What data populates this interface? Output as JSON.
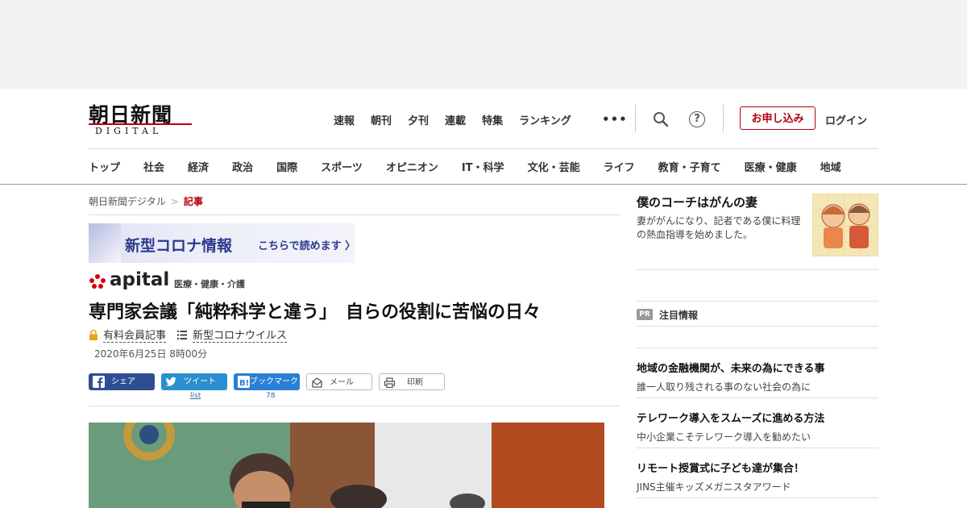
{
  "logo": {
    "main": "朝日新聞",
    "sub": "DIGITAL"
  },
  "top_nav": [
    "速報",
    "朝刊",
    "夕刊",
    "連載",
    "特集",
    "ランキング"
  ],
  "header": {
    "more_icon": "more-dots-icon",
    "signup_label": "お申し込み",
    "login_label": "ログイン"
  },
  "categories": [
    "トップ",
    "社会",
    "経済",
    "政治",
    "国際",
    "スポーツ",
    "オピニオン",
    "IT・科学",
    "文化・芸能",
    "ライフ",
    "教育・子育て",
    "医療・健康",
    "地域"
  ],
  "breadcrumb": {
    "home": "朝日新聞デジタル",
    "current": "記事"
  },
  "banner": {
    "title": "新型コロナ情報",
    "link": "こちらで読めます"
  },
  "apital": {
    "name": "apital",
    "category": "医療・健康・介護"
  },
  "article": {
    "headline": "専門家会議「純粋科学と違う」　自らの役割に苦悩の日々",
    "member_label": "有料会員記事",
    "topic": "新型コロナウイルス",
    "date": "2020年6月25日 8時00分"
  },
  "share": {
    "facebook": "シェア",
    "twitter": "ツイート",
    "hatena": "ブックマーク",
    "mail": "メール",
    "print": "印刷",
    "twitter_count": "list",
    "hatena_count": "78"
  },
  "sidebar": {
    "feature": {
      "title": "僕のコーチはがんの妻",
      "desc": "妻ががんになり、記者である僕に料理の熱血指導を始めました。"
    },
    "pr_label": "PR",
    "pr_title": "注目情報",
    "items": [
      {
        "title": "地域の金融機関が、未来の為にできる事",
        "sub": "誰一人取り残される事のない社会の為に"
      },
      {
        "title": "テレワーク導入をスムーズに進める方法",
        "sub": "中小企業こそテレワーク導入を勧めたい"
      },
      {
        "title": "リモート授賞式に子ども達が集合！",
        "sub": "JINS主催キッズメガニスタアワード"
      }
    ]
  },
  "colors": {
    "accent": "#b4000f",
    "banner_text": "#2d3a8c",
    "facebook": "#2e4e93",
    "twitter": "#2b8fcf",
    "hatena": "#2a7fd6"
  }
}
